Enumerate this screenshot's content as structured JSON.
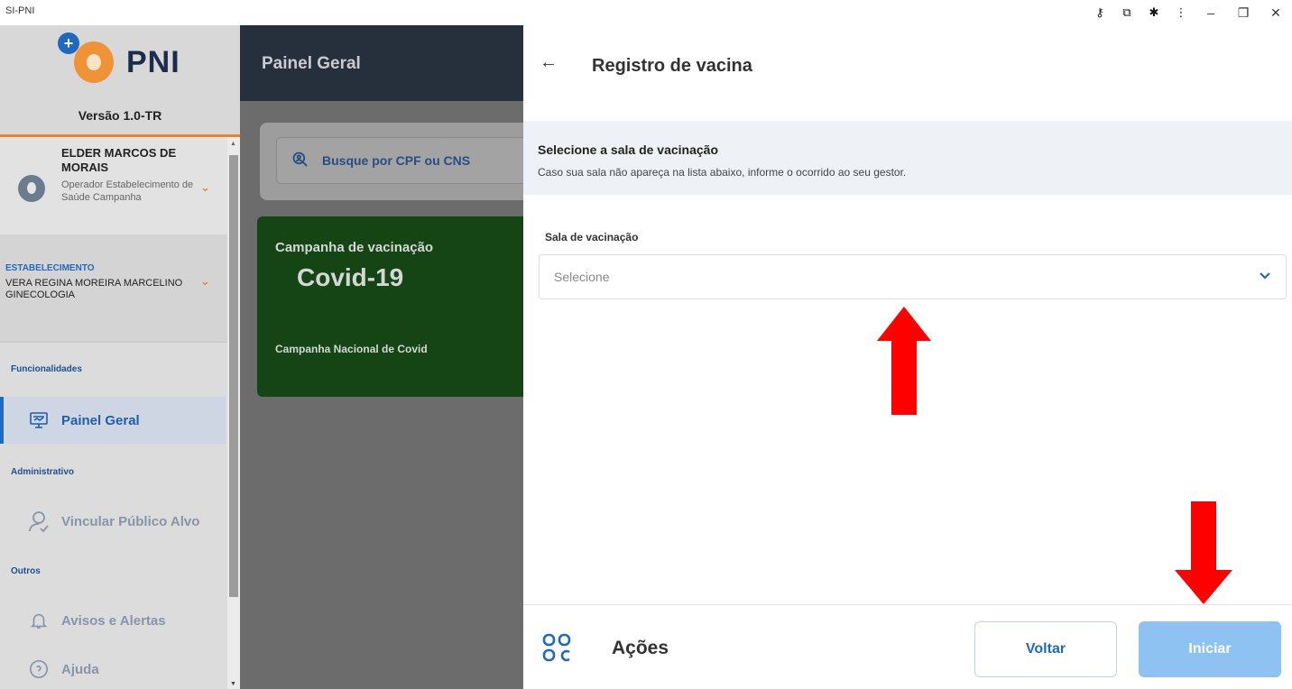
{
  "window": {
    "title": "SI-PNI",
    "controls": [
      "key-icon",
      "translate-icon",
      "extensions-icon",
      "more-icon",
      "minimize-icon",
      "restore-icon",
      "close-icon"
    ]
  },
  "sidebar": {
    "logo_text": "PNI",
    "version": "Versão 1.0-TR",
    "user": {
      "name": "ELDER MARCOS DE MORAIS",
      "role": "Operador Estabelecimento de Saúde Campanha"
    },
    "establishment": {
      "label": "ESTABELECIMENTO",
      "name": "VERA REGINA MOREIRA MARCELINO GINECOLOGIA"
    },
    "sections": {
      "funcionalidades": "Funcionalidades",
      "administrativo": "Administrativo",
      "outros": "Outros"
    },
    "items": {
      "painel_geral": "Painel Geral",
      "vincular": "Vincular Público Alvo",
      "avisos": "Avisos e Alertas",
      "ajuda": "Ajuda"
    }
  },
  "main": {
    "title": "Painel Geral",
    "search_placeholder": "Busque por CPF ou CNS",
    "campaign": {
      "label": "Campanha de vacinação",
      "name": "Covid-19",
      "description": "Campanha Nacional de Covid"
    }
  },
  "panel": {
    "title": "Registro de vacina",
    "info_heading": "Selecione a sala de vacinação",
    "info_text": "Caso sua sala não apareça na lista abaixo, informe o ocorrido ao seu gestor.",
    "field_label": "Sala de vacinação",
    "select_placeholder": "Selecione",
    "footer": {
      "actions_label": "Ações",
      "back_button": "Voltar",
      "start_button": "Iniciar"
    }
  },
  "colors": {
    "accent": "#1f6ac0",
    "brand_orange": "#f09236",
    "annotation_arrow": "#ff0000",
    "start_button_disabled": "#8ec2f2",
    "campaign_green": "#154515"
  }
}
